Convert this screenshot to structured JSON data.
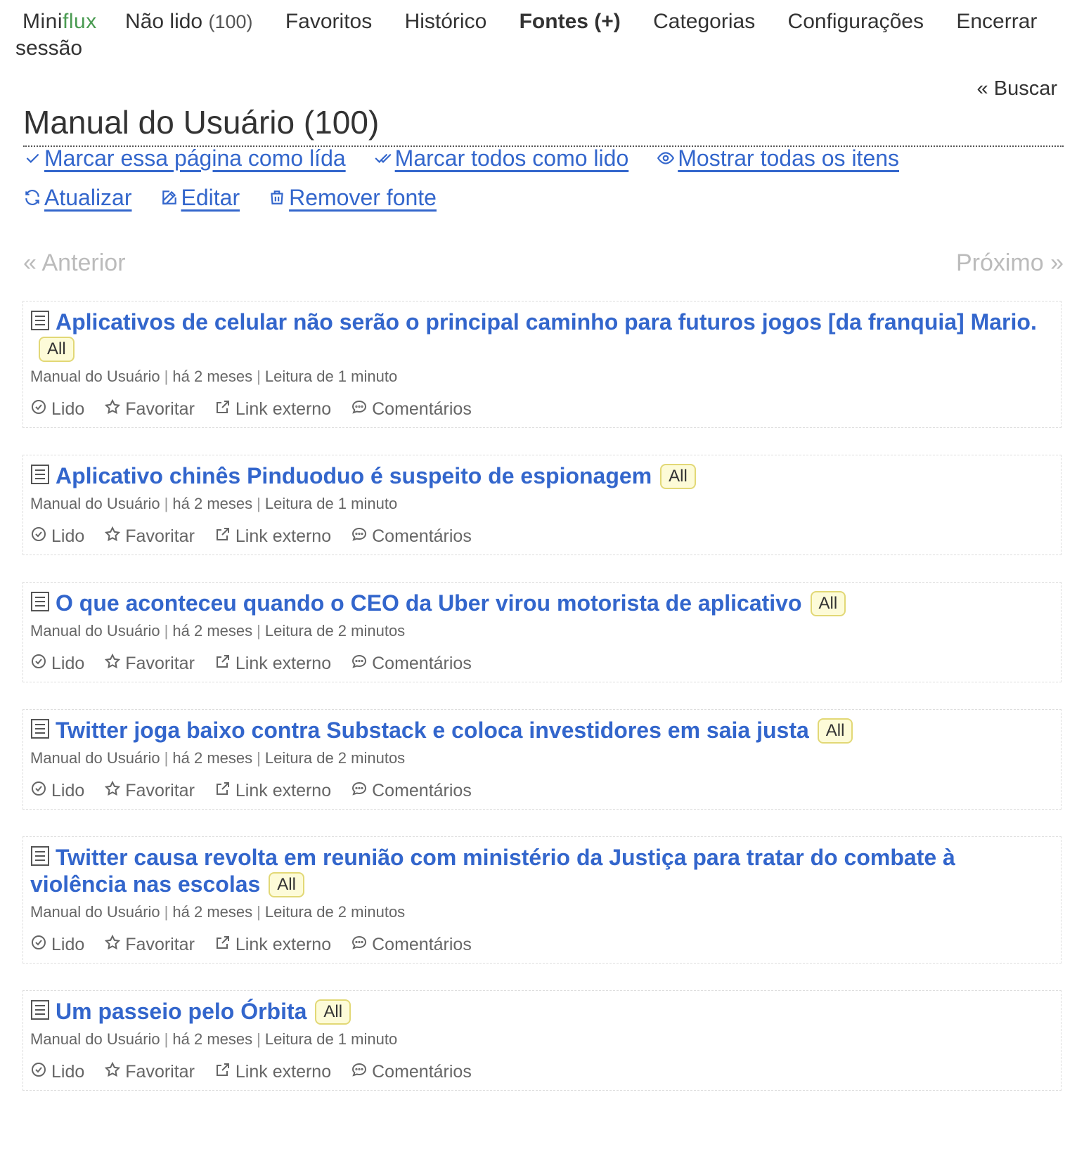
{
  "nav": {
    "logo_mini": "Mini",
    "logo_flux": "flux",
    "unread_label": "Não lido",
    "unread_count": "(100)",
    "starred": "Favoritos",
    "history": "Histórico",
    "feeds": "Fontes (+)",
    "categories": "Categorias",
    "settings": "Configurações",
    "logout": "Encerrar sessão"
  },
  "search_link": "« Buscar",
  "page_title": "Manual do Usuário (100)",
  "actions": {
    "mark_page_read": "Marcar essa página como lída",
    "mark_all_read": "Marcar todos como lido",
    "show_all": "Mostrar todas os itens",
    "refresh": "Atualizar",
    "edit": "Editar",
    "remove_feed": "Remover fonte"
  },
  "pagination": {
    "previous": "« Anterior",
    "next": "Próximo »"
  },
  "entry_actions": {
    "read": "Lido",
    "star": "Favoritar",
    "external": "Link externo",
    "comments": "Comentários"
  },
  "entries": [
    {
      "title": "Aplicativos de celular não serão o principal caminho para futuros jogos [da franquia] Mario.",
      "tag": "All",
      "feed": "Manual do Usuário",
      "date": "há 2 meses",
      "reading": "Leitura de 1 minuto"
    },
    {
      "title": "Aplicativo chinês Pinduoduo é suspeito de espionagem",
      "tag": "All",
      "feed": "Manual do Usuário",
      "date": "há 2 meses",
      "reading": "Leitura de 1 minuto"
    },
    {
      "title": "O que aconteceu quando o CEO da Uber virou motorista de aplicativo",
      "tag": "All",
      "feed": "Manual do Usuário",
      "date": "há 2 meses",
      "reading": "Leitura de 2 minutos"
    },
    {
      "title": "Twitter joga baixo contra Substack e coloca investidores em saia justa",
      "tag": "All",
      "feed": "Manual do Usuário",
      "date": "há 2 meses",
      "reading": "Leitura de 2 minutos"
    },
    {
      "title": "Twitter causa revolta em reunião com ministério da Justiça para tratar do combate à violência nas escolas",
      "tag": "All",
      "feed": "Manual do Usuário",
      "date": "há 2 meses",
      "reading": "Leitura de 2 minutos"
    },
    {
      "title": "Um passeio pelo Órbita",
      "tag": "All",
      "feed": "Manual do Usuário",
      "date": "há 2 meses",
      "reading": "Leitura de 1 minuto"
    }
  ]
}
